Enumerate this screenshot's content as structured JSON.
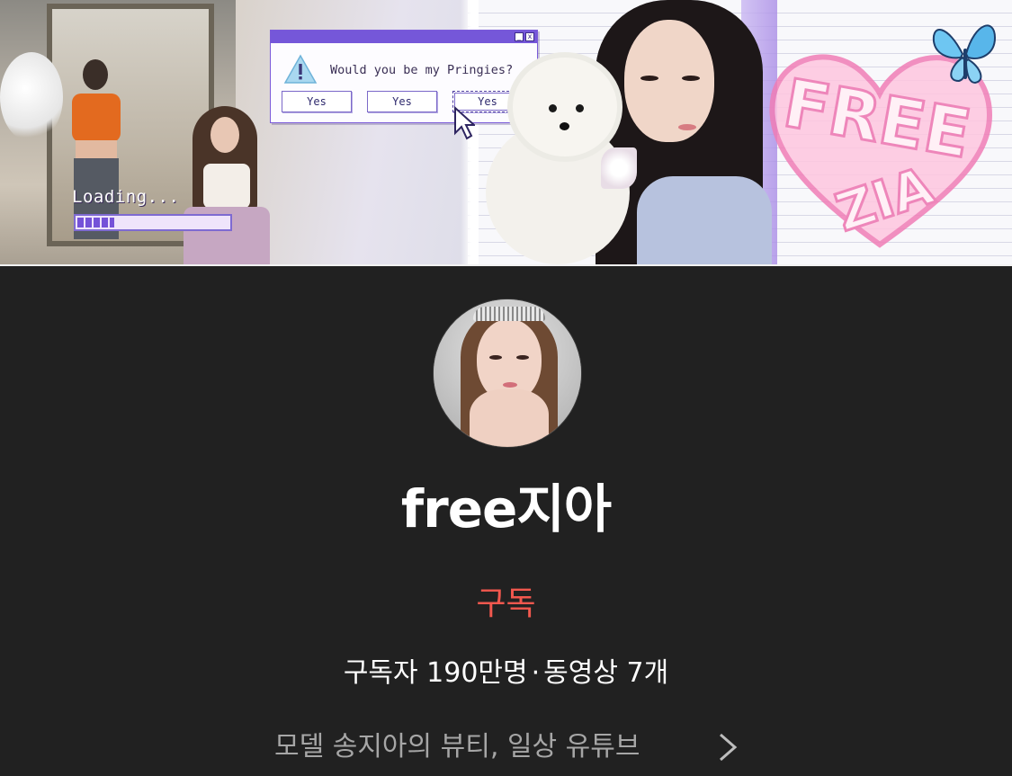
{
  "banner": {
    "loading_label": "Loading...",
    "loading_progress": 0.26,
    "dialog": {
      "question": "Would you be my Pringies?",
      "buttons": [
        "Yes",
        "Yes",
        "Yes"
      ],
      "minimize_glyph": "_",
      "close_glyph": "x"
    },
    "colors": {
      "accent_purple": "#7557d9",
      "pink": "#ec7fb5"
    }
  },
  "channel": {
    "name": "free지아",
    "subscribe_label": "구독",
    "subscribers": "구독자 190만명",
    "separator": "·",
    "videos": "동영상 7개",
    "description": "모델 송지아의 뷰티, 일상 유튜브",
    "icons": {
      "avatar": "profile-photo",
      "chevron": "chevron-right-icon"
    },
    "colors": {
      "background": "#212121",
      "subscribe": "#f2584e",
      "description": "#a6a6a6"
    }
  }
}
